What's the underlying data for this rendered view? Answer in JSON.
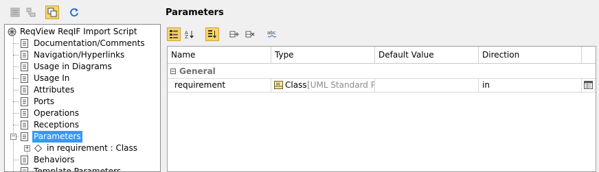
{
  "toolbar": {
    "buttons": [
      {
        "icon": "list-view-icon",
        "active": false
      },
      {
        "icon": "hierarchy-view-icon",
        "active": false
      },
      {
        "icon": "copy-layout-icon",
        "active": true
      },
      {
        "icon": "refresh-icon",
        "active": false
      }
    ]
  },
  "panel_title": "Parameters",
  "tree": {
    "root": {
      "label": "ReqView ReqIF Import Script",
      "icon": "class-icon"
    },
    "items": [
      {
        "label": "Documentation/Comments"
      },
      {
        "label": "Navigation/Hyperlinks"
      },
      {
        "label": "Usage in Diagrams"
      },
      {
        "label": "Usage In"
      },
      {
        "label": "Attributes"
      },
      {
        "label": "Ports"
      },
      {
        "label": "Operations"
      },
      {
        "label": "Receptions"
      },
      {
        "label": "Parameters",
        "selected": true
      },
      {
        "label": "in requirement : Class",
        "child": true
      },
      {
        "label": "Behaviors"
      },
      {
        "label": "Template Parameters"
      }
    ]
  },
  "grid_toolbar": {
    "buttons": [
      {
        "icon": "categorized-view-icon",
        "active": true
      },
      {
        "icon": "sort-alphabetical-icon",
        "active": false
      },
      {
        "icon": "sort-order-icon",
        "active": true
      },
      {
        "icon": "add-row-icon",
        "active": false
      },
      {
        "icon": "remove-row-icon",
        "active": false
      },
      {
        "icon": "spelling-icon",
        "active": false
      }
    ]
  },
  "grid": {
    "columns": [
      "Name",
      "Type",
      "Default Value",
      "Direction"
    ],
    "group": {
      "expander": "⊟",
      "label": "General"
    },
    "rows": [
      {
        "name": "requirement",
        "type_main": "Class",
        "type_extra": "[UML Standard P...",
        "default_value": "",
        "direction": "in"
      }
    ]
  }
}
